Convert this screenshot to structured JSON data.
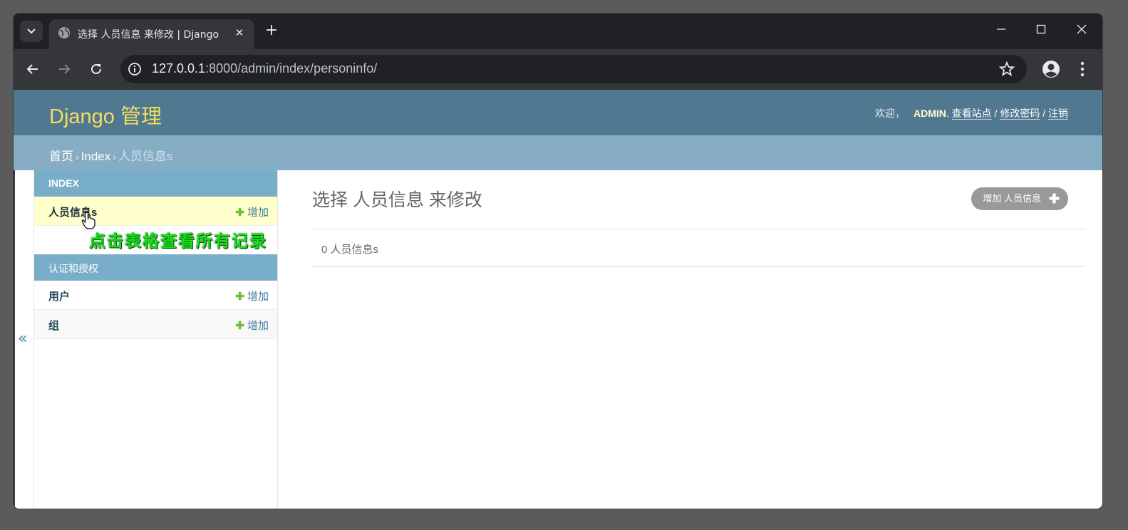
{
  "browser": {
    "tab_title": "选择 人员信息 来修改 | Django",
    "url_host": "127.0.0.1",
    "url_path": ":8000/admin/index/personinfo/"
  },
  "admin": {
    "brand": "Django 管理",
    "welcome": "欢迎，",
    "username": "ADMIN",
    "view_site": "查看站点",
    "change_password": "修改密码",
    "logout": "注销",
    "separator": "/"
  },
  "breadcrumbs": {
    "home": "首页",
    "app": "Index",
    "current": "人员信息s"
  },
  "sidebar": {
    "collapse_label": "«",
    "modules": [
      {
        "caption": "INDEX",
        "models": [
          {
            "name": "人员信息s",
            "add_label": "增加",
            "selected": true
          }
        ]
      },
      {
        "caption": "认证和授权",
        "models": [
          {
            "name": "用户",
            "add_label": "增加"
          },
          {
            "name": "组",
            "add_label": "增加"
          }
        ]
      }
    ]
  },
  "annotation": "点击表格查看所有记录",
  "content": {
    "title": "选择 人员信息 来修改",
    "add_button": "增加 人员信息",
    "result_count": "0 人员信息s"
  },
  "colors": {
    "header_bg": "#517891",
    "breadcrumb_bg": "#87adc4",
    "brand_yellow": "#f5dd5d",
    "add_green": "#70bf2b",
    "annotation_green": "#16dd1b"
  }
}
